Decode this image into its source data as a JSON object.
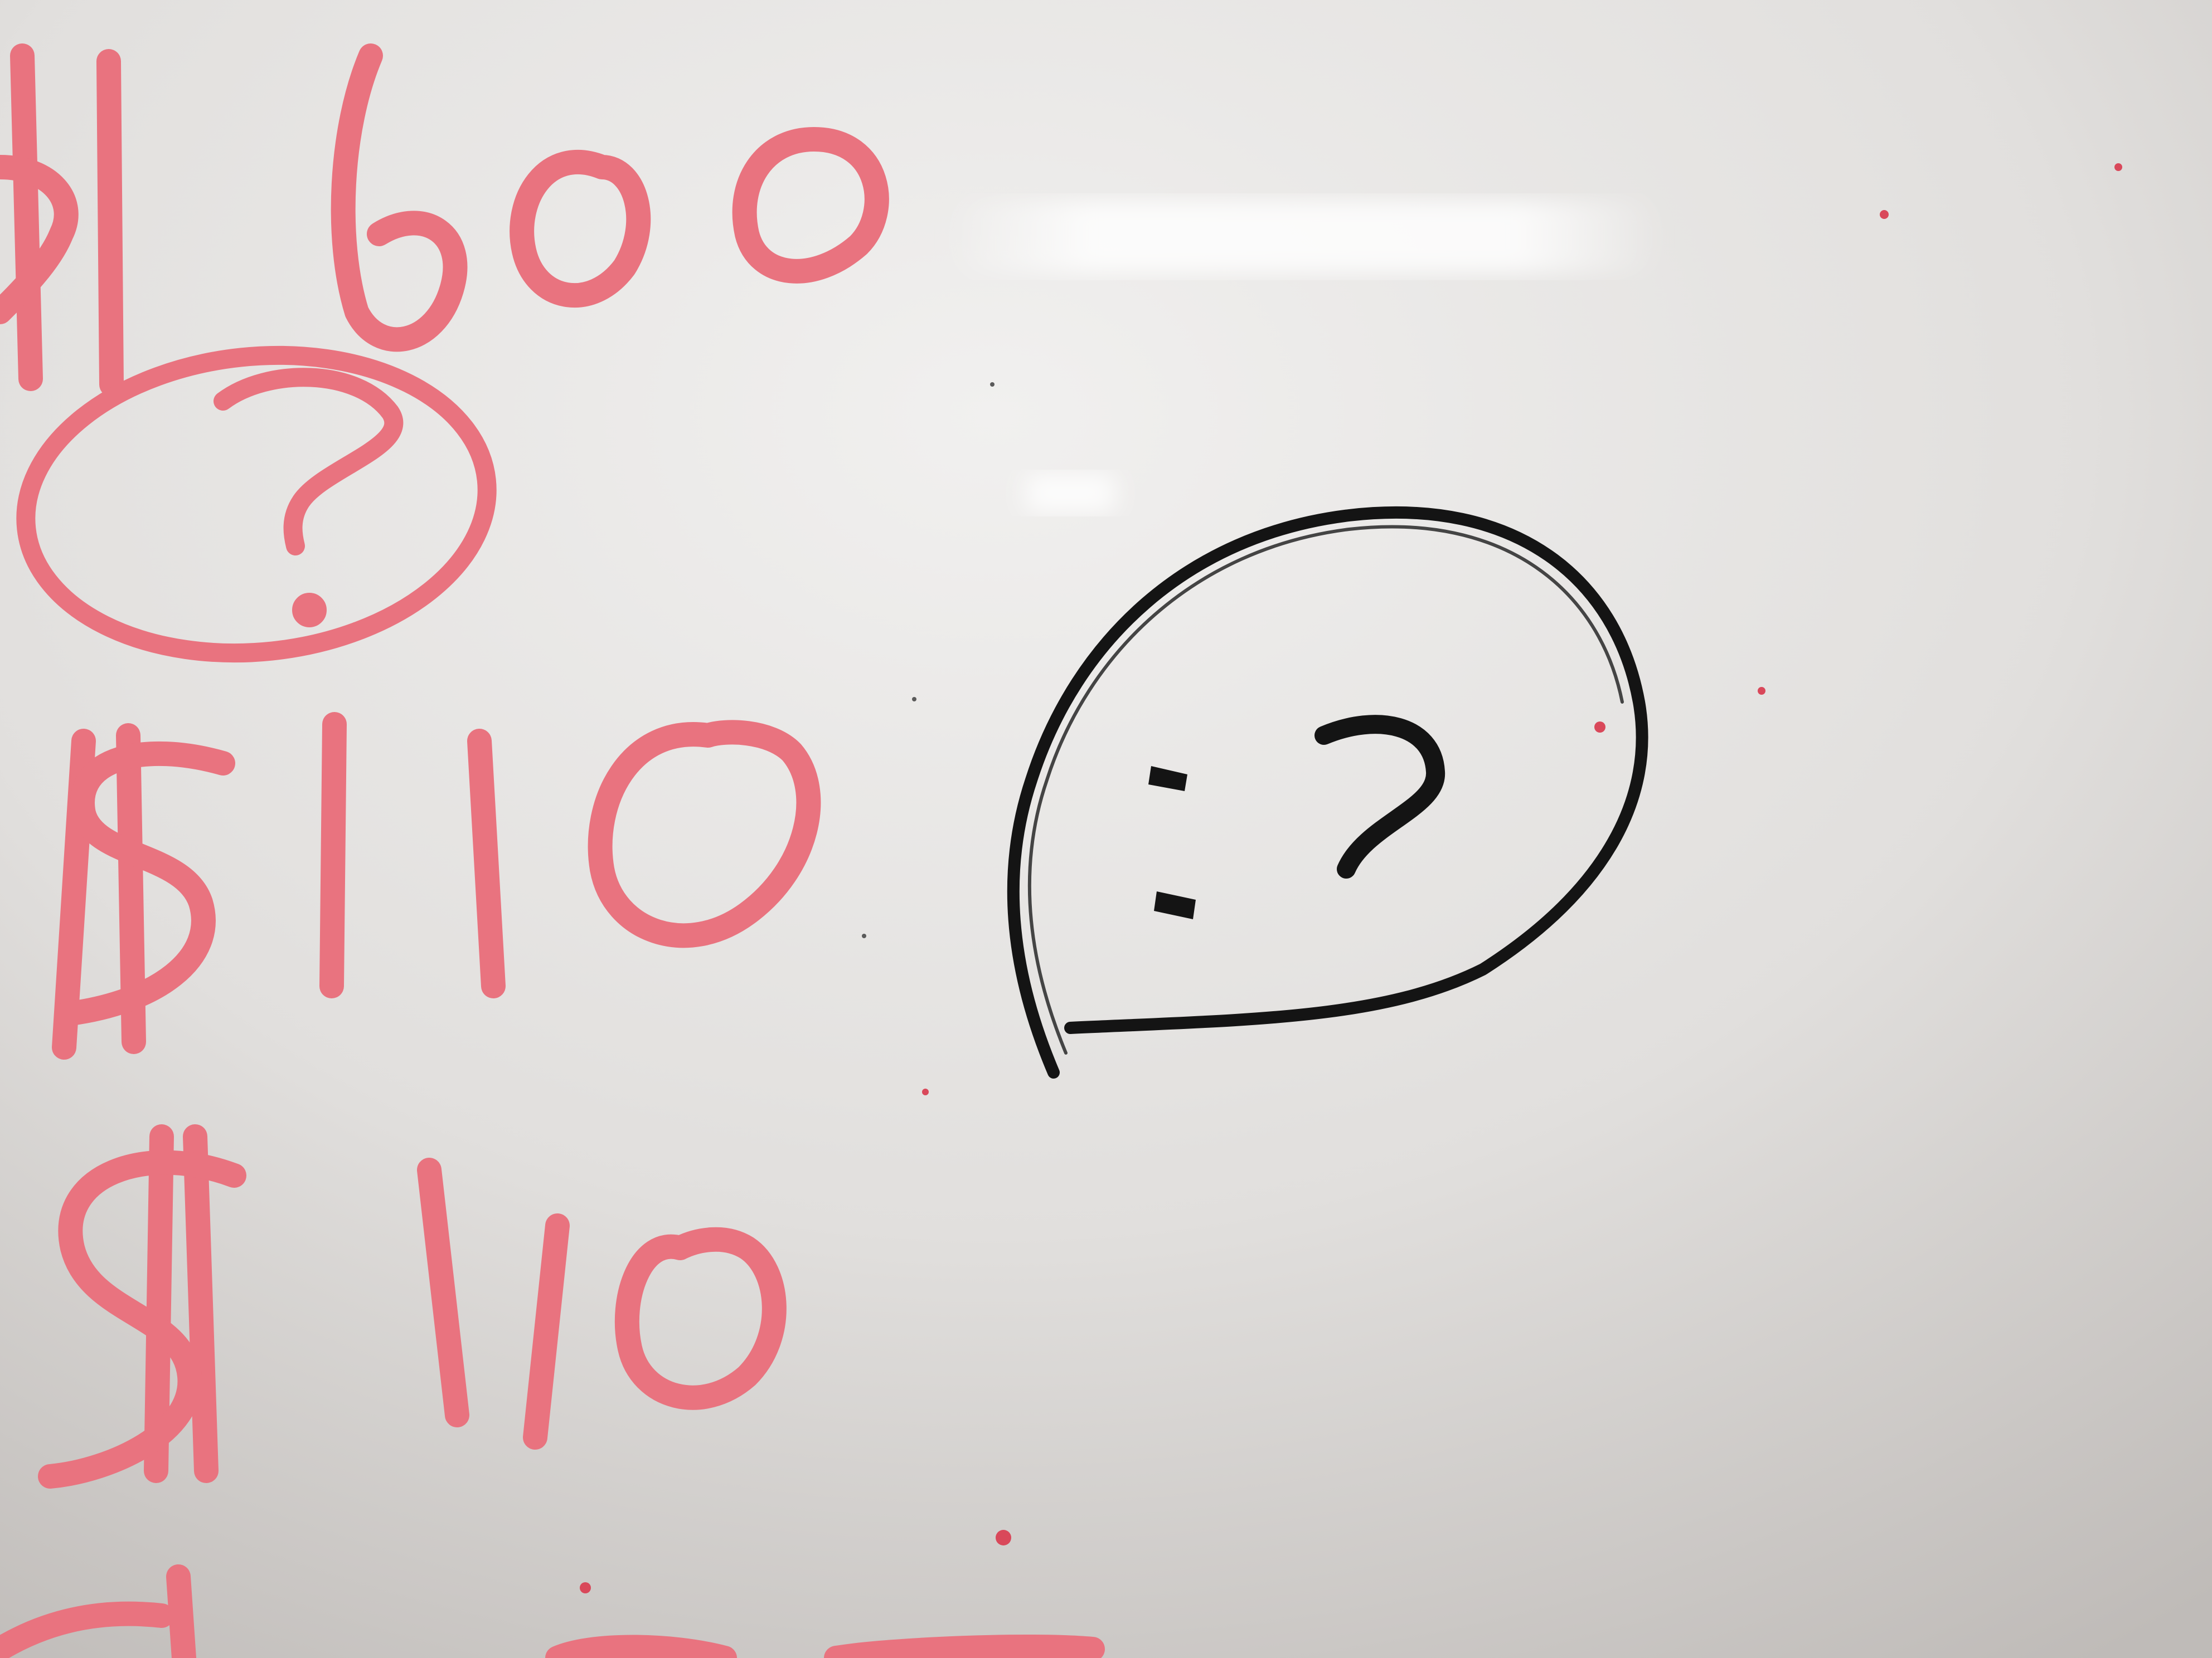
{
  "scene": {
    "description_label": "whiteboard",
    "colors": {
      "board_light": "#ecebea",
      "board_mid": "#d8d6d4",
      "board_shadow": "#bdb9b6",
      "red_marker": "#e9737f",
      "red_marker_core": "#f1a2ab",
      "black_marker": "#141414"
    }
  },
  "red_writing": {
    "line1": {
      "symbol": "$",
      "amount": "600"
    },
    "circled_mark": "?",
    "line2": {
      "symbol": "$",
      "amount": "110"
    },
    "line3": {
      "symbol": "$",
      "amount": "110"
    }
  },
  "speech_bubble": {
    "icon": "speech-bubble-icon",
    "content": ":?"
  }
}
